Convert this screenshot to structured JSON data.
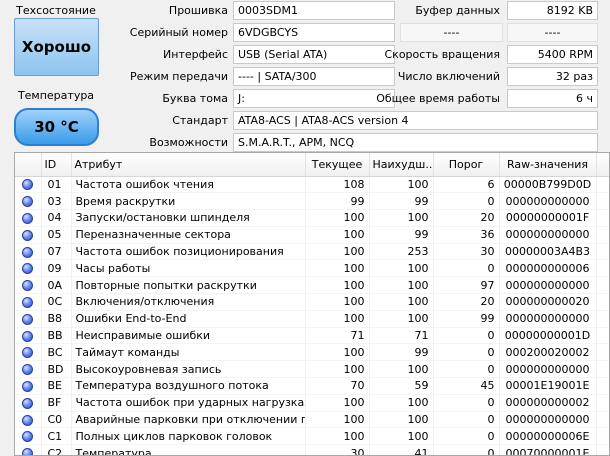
{
  "status": {
    "health_label": "Техсостояние",
    "health_value": "Хорошо",
    "temp_label": "Температура",
    "temp_value": "30 °C"
  },
  "info": {
    "firmware_label": "Прошивка",
    "firmware_value": "0003SDM1",
    "serial_label": "Серийный номер",
    "serial_value": "6VDGBCYS",
    "interface_label": "Интерфейс",
    "interface_value": "USB (Serial ATA)",
    "transfer_label": "Режим передачи",
    "transfer_value": "---- | SATA/300",
    "volume_label": "Буква тома",
    "volume_value": "J:",
    "standard_label": "Стандарт",
    "standard_value": "ATA8-ACS | ATA8-ACS version 4",
    "features_label": "Возможности",
    "features_value": "S.M.A.R.T., APM, NCQ",
    "buffer_label": "Буфер данных",
    "buffer_value": "8192 KB",
    "blank1_value": "----",
    "blank2_value": "----",
    "rpm_label": "Скорость вращения",
    "rpm_value": "5400 RPM",
    "power_count_label": "Число включений",
    "power_count_value": "32 раз",
    "power_hours_label": "Общее время работы",
    "power_hours_value": "6 ч"
  },
  "table": {
    "headers": {
      "id": "ID",
      "attribute": "Атрибут",
      "current": "Текущее",
      "worst": "Наихудш...",
      "threshold": "Порог",
      "raw": "Raw-значения"
    },
    "rows": [
      {
        "id": "01",
        "name": "Частота ошибок чтения",
        "current": "108",
        "worst": "100",
        "threshold": "6",
        "raw": "00000B799D0D"
      },
      {
        "id": "03",
        "name": "Время раскрутки",
        "current": "99",
        "worst": "99",
        "threshold": "0",
        "raw": "000000000000"
      },
      {
        "id": "04",
        "name": "Запуски/остановки шпинделя",
        "current": "100",
        "worst": "100",
        "threshold": "20",
        "raw": "00000000001F"
      },
      {
        "id": "05",
        "name": "Переназначенные сектора",
        "current": "100",
        "worst": "99",
        "threshold": "36",
        "raw": "000000000000"
      },
      {
        "id": "07",
        "name": "Частота ошибок позиционирования",
        "current": "100",
        "worst": "253",
        "threshold": "30",
        "raw": "00000003A4B3"
      },
      {
        "id": "09",
        "name": "Часы работы",
        "current": "100",
        "worst": "100",
        "threshold": "0",
        "raw": "000000000006"
      },
      {
        "id": "0A",
        "name": "Повторные попытки раскрутки",
        "current": "100",
        "worst": "100",
        "threshold": "97",
        "raw": "000000000000"
      },
      {
        "id": "0C",
        "name": "Включения/отключения",
        "current": "100",
        "worst": "100",
        "threshold": "20",
        "raw": "000000000020"
      },
      {
        "id": "B8",
        "name": "Ошибки End-to-End",
        "current": "100",
        "worst": "100",
        "threshold": "99",
        "raw": "000000000000"
      },
      {
        "id": "BB",
        "name": "Неисправимые ошибки",
        "current": "71",
        "worst": "71",
        "threshold": "0",
        "raw": "00000000001D"
      },
      {
        "id": "BC",
        "name": "Таймаут команды",
        "current": "100",
        "worst": "99",
        "threshold": "0",
        "raw": "000200020002"
      },
      {
        "id": "BD",
        "name": "Высокоуровневая запись",
        "current": "100",
        "worst": "100",
        "threshold": "0",
        "raw": "000000000000"
      },
      {
        "id": "BE",
        "name": "Температура воздушного потока",
        "current": "70",
        "worst": "59",
        "threshold": "45",
        "raw": "00001E19001E"
      },
      {
        "id": "BF",
        "name": "Частота ошибок при ударных нагрузках",
        "current": "100",
        "worst": "100",
        "threshold": "0",
        "raw": "000000000002"
      },
      {
        "id": "C0",
        "name": "Аварийные парковки при отключении пи...",
        "current": "100",
        "worst": "100",
        "threshold": "0",
        "raw": "000000000000"
      },
      {
        "id": "C1",
        "name": "Полных циклов парковок головок",
        "current": "100",
        "worst": "100",
        "threshold": "0",
        "raw": "00000000006E"
      },
      {
        "id": "C2",
        "name": "Температура",
        "current": "30",
        "worst": "41",
        "threshold": "0",
        "raw": "00070000001E"
      }
    ]
  }
}
